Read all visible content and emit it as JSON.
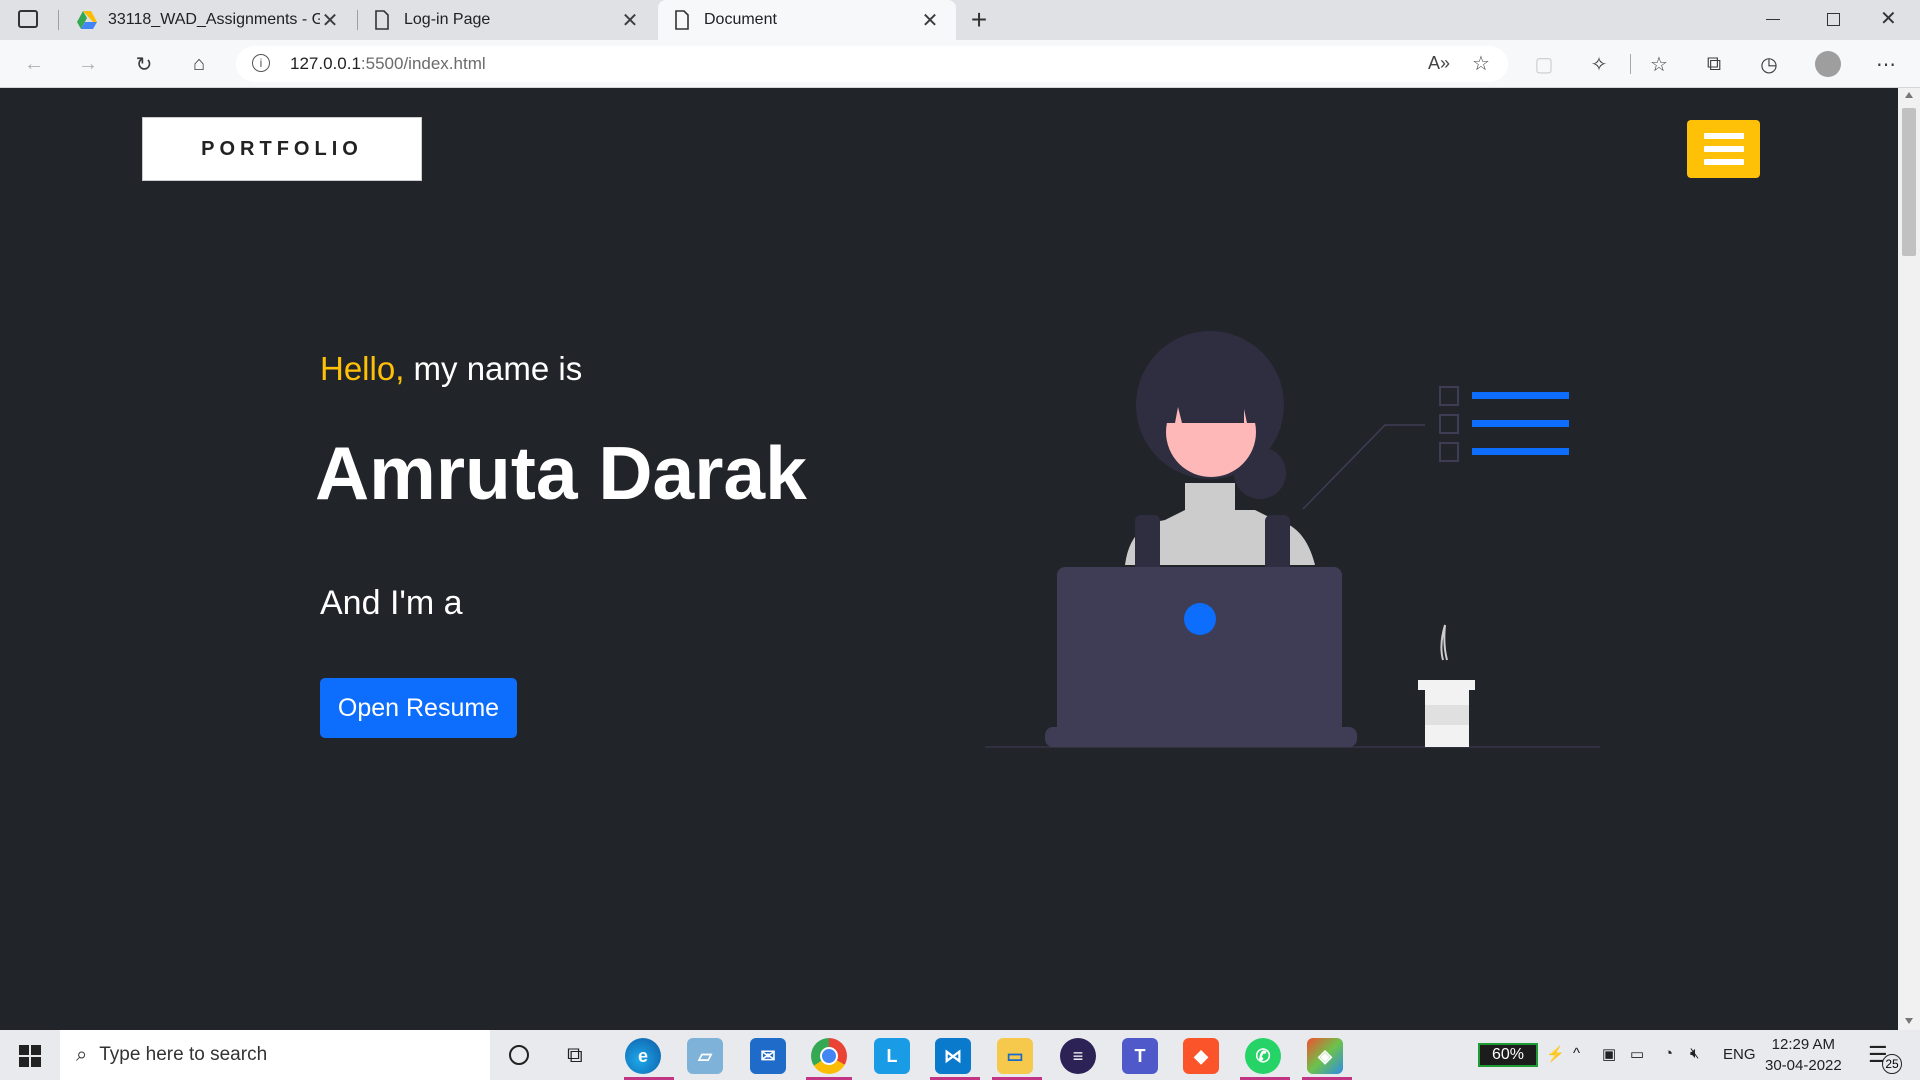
{
  "browser": {
    "tabs": [
      {
        "title": "33118_WAD_Assignments - Goo",
        "icon": "google-drive-icon"
      },
      {
        "title": "Log-in Page",
        "icon": "document-icon"
      },
      {
        "title": "Document",
        "icon": "document-icon"
      }
    ],
    "url_host": "127.0.0.1",
    "url_rest": ":5500/index.html"
  },
  "page": {
    "logo": "PORTFOLIO",
    "greeting_highlight": "Hello,",
    "greeting_rest": " my name is",
    "name": "Amruta Darak",
    "role_prefix": "And I'm a",
    "resume_button": "Open Resume"
  },
  "taskbar": {
    "search_placeholder": "Type here to search",
    "battery": "60%",
    "language": "ENG",
    "time": "12:29 AM",
    "date": "30-04-2022",
    "notifications": "25"
  },
  "colors": {
    "accent": "#ffc107",
    "primary": "#0d6efd",
    "background": "#212429"
  }
}
